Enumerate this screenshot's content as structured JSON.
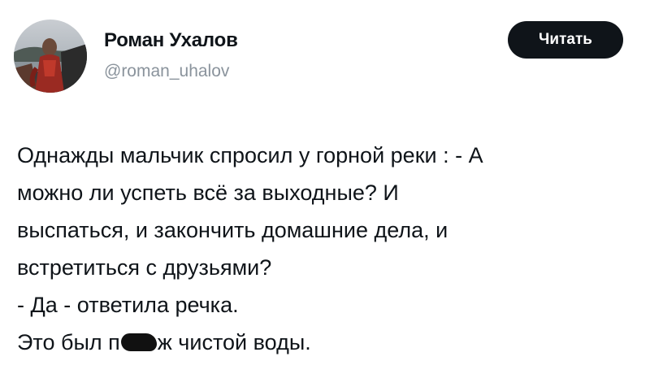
{
  "author": {
    "name": "Роман Ухалов",
    "handle": "@roman_uhalov"
  },
  "follow_button": {
    "label": "Читать"
  },
  "tweet": {
    "lines": [
      "Однажды мальчик спросил у горной реки : - А",
      "можно ли успеть всё за выходные? И",
      "выспаться, и закончить домашние дела, и",
      "встретиться с друзьями?",
      "- Да - ответила речка."
    ],
    "last_line_before": "Это был п",
    "last_line_after": "ж чистой воды."
  },
  "colors": {
    "text": "#0f1419",
    "handle": "#8a939c",
    "button_bg": "#0f1419",
    "button_text": "#ffffff",
    "redaction": "#111111"
  }
}
